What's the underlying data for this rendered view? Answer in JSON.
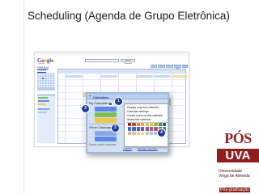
{
  "slide": {
    "title": "Scheduling (Agenda de Grupo Eletrônica)"
  },
  "calendar_app": {
    "logo_letters": [
      "G",
      "o",
      "o",
      "g",
      "l",
      "e"
    ],
    "logo_sub": "Calendar",
    "search_button": "Search Calendars",
    "view_tabs": [
      "Day",
      "Week",
      "Month",
      "Next 4 days",
      "Agenda"
    ],
    "create_event": "Create Event",
    "quick_add": "Quick Add"
  },
  "calendar_panel": {
    "header": "Calendars",
    "my_calendars": "My Calendars",
    "other_calendars": "Other Calendars",
    "search_placeholder": "Search public calendars",
    "calendar_colors": [
      "#5c8ae6",
      "#7dbf52",
      "#e9c84a",
      "#8aa8e6"
    ],
    "footer_links": [
      "Settings",
      "Manage calendars"
    ]
  },
  "context_menu": {
    "items": [
      "Display only this Calendar",
      "Calendar settings",
      "Create event on this calendar",
      "Share this calendar"
    ],
    "swatches": [
      [
        "#a3232f",
        "#d0413e",
        "#e7804a",
        "#f0a733",
        "#f6c02a",
        "#cbd14a",
        "#86bc4f",
        "#3e8c58",
        "#1f6f5a"
      ],
      [
        "#2d7ea3",
        "#3d66c4",
        "#4f5fb8",
        "#6d56b2",
        "#8e4ca6",
        "#b1528a",
        "#c44f6a",
        "#9a6a4b",
        "#6d7b84"
      ],
      [
        "#e7a9b0",
        "#f0b79c",
        "#f7d58f",
        "#dfe59a",
        "#b6daa0",
        "#9fd3c5",
        "#a8c3ec",
        "#c1b0e3",
        "#d5b4d8"
      ]
    ]
  },
  "callouts": [
    "1",
    "2",
    "3",
    "4"
  ],
  "brand": {
    "top": "PÓS",
    "main": "UVA",
    "line1": "Universidade",
    "line2": "Veiga de Almeida",
    "postgrad": "Pós-graduação",
    "color": "#8e1f1f"
  }
}
